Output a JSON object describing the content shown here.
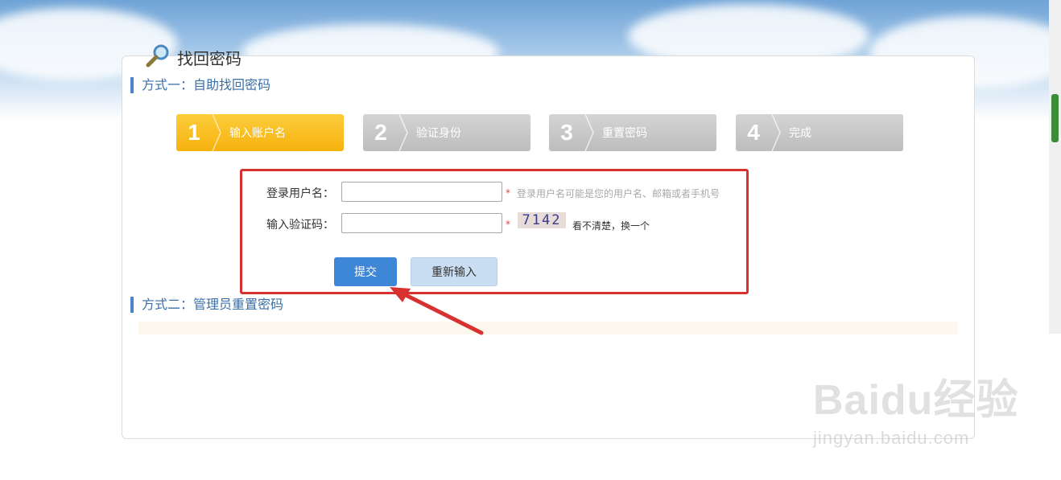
{
  "page": {
    "title": "找回密码",
    "method1_heading": "方式一：自助找回密码",
    "method2_heading": "方式二：管理员重置密码"
  },
  "steps": [
    {
      "num": "1",
      "label": "输入账户名",
      "active": true
    },
    {
      "num": "2",
      "label": "验证身份",
      "active": false
    },
    {
      "num": "3",
      "label": "重置密码",
      "active": false
    },
    {
      "num": "4",
      "label": "完成",
      "active": false
    }
  ],
  "form": {
    "username_label": "登录用户名：",
    "username_value": "",
    "required_mark": "*",
    "username_hint": "登录用户名可能是您的用户名、邮箱或者手机号",
    "captcha_label": "输入验证码：",
    "captcha_value": "",
    "captcha_code": "7142",
    "refresh_text": "看不清楚，换一个",
    "submit_label": "提交",
    "reset_label": "重新输入"
  },
  "watermark": {
    "logo": "Baidu经验",
    "url": "jingyan.baidu.com"
  },
  "colors": {
    "active_step": "#f6b20e",
    "inactive_step": "#c8c8c8",
    "primary_button": "#3d87d6",
    "secondary_button": "#c9def2",
    "highlight_border": "#d93030",
    "annotation_arrow": "#d93030",
    "heading_text": "#3a6fa8"
  },
  "icons": {
    "title_icon": "magnifier-icon"
  }
}
